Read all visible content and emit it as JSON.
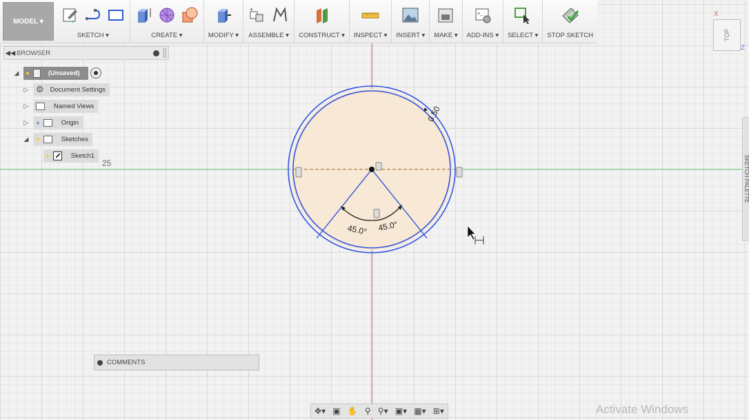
{
  "toolbar": {
    "workspace": "MODEL ▾",
    "groups": [
      {
        "id": "sketch",
        "label": "SKETCH ▾"
      },
      {
        "id": "create",
        "label": "CREATE ▾"
      },
      {
        "id": "modify",
        "label": "MODIFY ▾"
      },
      {
        "id": "assemble",
        "label": "ASSEMBLE ▾"
      },
      {
        "id": "construct",
        "label": "CONSTRUCT ▾"
      },
      {
        "id": "inspect",
        "label": "INSPECT ▾"
      },
      {
        "id": "insert",
        "label": "INSERT ▾"
      },
      {
        "id": "make",
        "label": "MAKE ▾"
      },
      {
        "id": "addins",
        "label": "ADD-INS ▾"
      },
      {
        "id": "select",
        "label": "SELECT ▾"
      },
      {
        "id": "stop",
        "label": "STOP SKETCH"
      }
    ]
  },
  "browser": {
    "title": "BROWSER",
    "items": [
      {
        "label": "(Unsaved)"
      },
      {
        "label": "Document Settings"
      },
      {
        "label": "Named Views"
      },
      {
        "label": "Origin"
      },
      {
        "label": "Sketches"
      },
      {
        "label": "Sketch1"
      }
    ],
    "stray_value": "25"
  },
  "sketch": {
    "dim_offset": "0.50",
    "angle_left": "45.0°",
    "angle_right": "45.0°"
  },
  "comments": {
    "label": "COMMENTS"
  },
  "viewcube": {
    "face": "TOP"
  },
  "sketch_palette": {
    "label": "SKETCH PALETTE"
  },
  "watermark": "Activate Windows",
  "colors": {
    "sketch_line": "#3355dd",
    "profile_fill": "#f8e8d6",
    "axis_red": "#e06060",
    "axis_green": "#6fc46f"
  }
}
